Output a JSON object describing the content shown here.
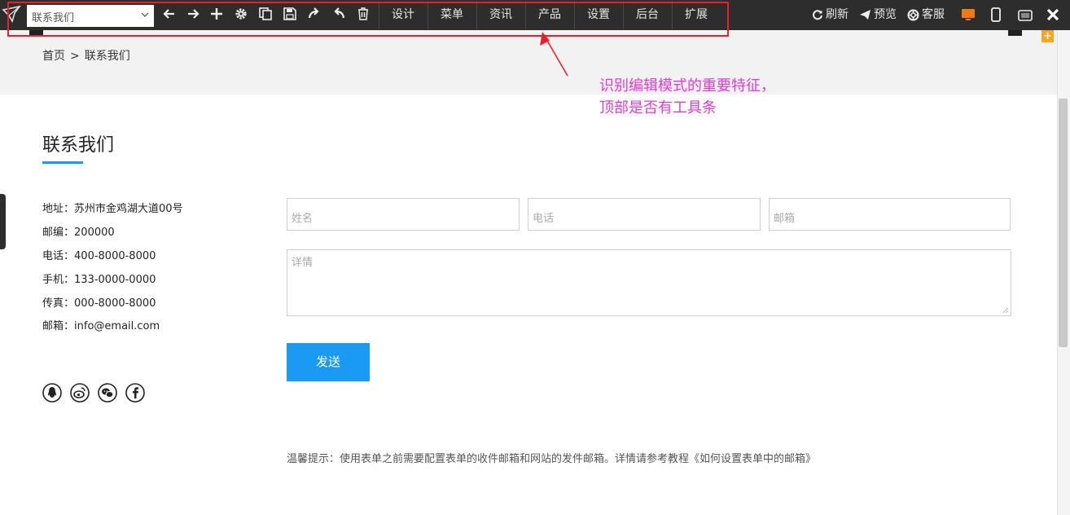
{
  "toolbar": {
    "page_select_value": "联系我们",
    "menu": [
      "设计",
      "菜单",
      "资讯",
      "产品",
      "设置",
      "后台",
      "扩展"
    ],
    "refresh_label": "刷新",
    "preview_label": "预览",
    "service_label": "客服",
    "icons": [
      "back-arrow",
      "forward-arrow",
      "add",
      "gear",
      "copy",
      "save",
      "redo",
      "undo",
      "trash"
    ],
    "colors": {
      "bar": "#2d2d2d",
      "highlight_box": "#e8202b"
    }
  },
  "breadcrumb": {
    "home": "首页",
    "separator": ">",
    "current": "联系我们"
  },
  "annotation": {
    "line1": "识别编辑模式的重要特征，",
    "line2": "顶部是否有工具条",
    "color": "#e23bd2"
  },
  "page": {
    "title": "联系我们",
    "accent_color": "#1a9af3",
    "contact": [
      {
        "label": "地址",
        "value": "苏州市金鸡湖大道00号"
      },
      {
        "label": "邮编",
        "value": "200000"
      },
      {
        "label": "电话",
        "value": "400-8000-8000"
      },
      {
        "label": "手机",
        "value": "133-0000-0000"
      },
      {
        "label": "传真",
        "value": "000-8000-8000"
      },
      {
        "label": "邮箱",
        "value": "info@email.com"
      }
    ],
    "social_icons": [
      "qq-icon",
      "weibo-icon",
      "wechat-icon",
      "facebook-icon"
    ]
  },
  "form": {
    "name_placeholder": "姓名",
    "phone_placeholder": "电话",
    "email_placeholder": "邮箱",
    "detail_placeholder": "详情",
    "send_label": "发送",
    "tip": "温馨提示：使用表单之前需要配置表单的收件邮箱和网站的发件邮箱。详情请参考教程《如何设置表单中的邮箱》"
  }
}
